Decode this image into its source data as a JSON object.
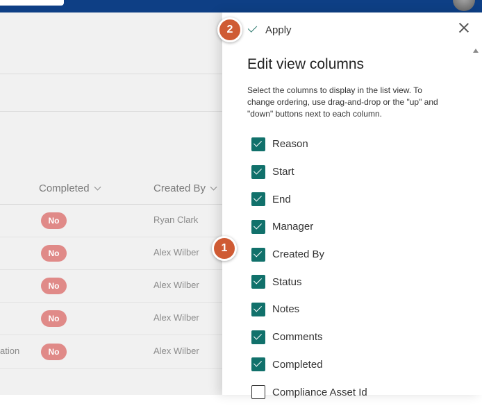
{
  "topbar": {
    "brand_color": "#0e3f85"
  },
  "list": {
    "columns": {
      "completed": "Completed",
      "created_by": "Created By"
    },
    "rows": [
      {
        "left_text": "",
        "completed": "No",
        "created_by": "Ryan Clark"
      },
      {
        "left_text": "",
        "completed": "No",
        "created_by": "Alex Wilber"
      },
      {
        "left_text": "",
        "completed": "No",
        "created_by": "Alex Wilber"
      },
      {
        "left_text": "",
        "completed": "No",
        "created_by": "Alex Wilber"
      },
      {
        "left_text": "ation",
        "completed": "No",
        "created_by": "Alex Wilber"
      }
    ],
    "pill_color": "#e08a88"
  },
  "panel": {
    "apply_label": "Apply",
    "close_icon": "close-icon",
    "title": "Edit view columns",
    "description": "Select the columns to display in the list view. To change ordering, use drag-and-drop or the \"up\" and \"down\" buttons next to each column.",
    "checkbox_color": "#11716b",
    "columns": [
      {
        "label": "Reason",
        "checked": true
      },
      {
        "label": "Start",
        "checked": true
      },
      {
        "label": "End",
        "checked": true
      },
      {
        "label": "Manager",
        "checked": true
      },
      {
        "label": "Created By",
        "checked": true
      },
      {
        "label": "Status",
        "checked": true
      },
      {
        "label": "Notes",
        "checked": true
      },
      {
        "label": "Comments",
        "checked": true
      },
      {
        "label": "Completed",
        "checked": true
      },
      {
        "label": "Compliance Asset Id",
        "checked": false
      }
    ]
  },
  "badges": {
    "step1": "1",
    "step2": "2",
    "color": "#cf5b34"
  }
}
